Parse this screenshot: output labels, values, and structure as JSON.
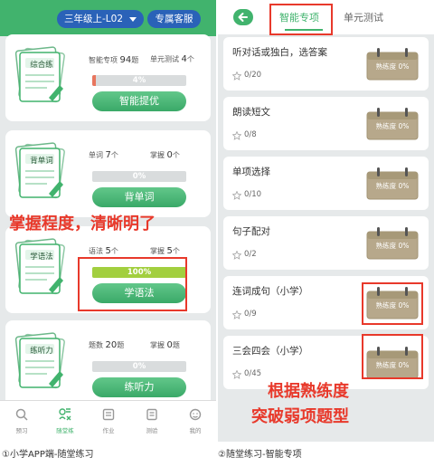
{
  "left": {
    "grade_selector": "三年级上-L02",
    "service_button": "专属客服",
    "cards": [
      {
        "illus_label": "综合练",
        "stat1_label": "智能专项",
        "stat1_value": "94",
        "stat1_unit": "题",
        "stat2_label": "单元测试",
        "stat2_value": "4",
        "stat2_unit": "个",
        "progress": "4%",
        "progress_value": 4,
        "bar_color": "#e8765e",
        "button": "智能提优"
      },
      {
        "illus_label": "背单词",
        "stat1_label": "单词",
        "stat1_value": "7",
        "stat1_unit": "个",
        "stat2_label": "掌握",
        "stat2_value": "0",
        "stat2_unit": "个",
        "progress": "0%",
        "progress_value": 0,
        "bar_color": "#d9dcdd",
        "button": "背单词"
      },
      {
        "illus_label": "学语法",
        "stat1_label": "语法",
        "stat1_value": "5",
        "stat1_unit": "个",
        "stat2_label": "掌握",
        "stat2_value": "5",
        "stat2_unit": "个",
        "progress": "100%",
        "progress_value": 100,
        "bar_color": "#a2cf3f",
        "button": "学语法"
      },
      {
        "illus_label": "练听力",
        "stat1_label": "题数",
        "stat1_value": "20",
        "stat1_unit": "题",
        "stat2_label": "掌握",
        "stat2_value": "0",
        "stat2_unit": "题",
        "progress": "0%",
        "progress_value": 0,
        "bar_color": "#d9dcdd",
        "button": "练听力"
      }
    ],
    "overlay_text": "掌握程度，清晰明了",
    "tabs": [
      {
        "label": "预习",
        "icon": "search-icon",
        "active": false
      },
      {
        "label": "随堂练",
        "icon": "class-practice-icon",
        "active": true
      },
      {
        "label": "作业",
        "icon": "homework-icon",
        "active": false
      },
      {
        "label": "测验",
        "icon": "quiz-icon",
        "active": false
      },
      {
        "label": "我的",
        "icon": "profile-icon",
        "active": false
      }
    ],
    "caption": "①小学APP端-随堂练习"
  },
  "right": {
    "tabs": [
      "智能专项",
      "单元测试"
    ],
    "items": [
      {
        "title": "听对话或独白，选答案",
        "count": "0/20",
        "badge": "熟练度 0%"
      },
      {
        "title": "朗读短文",
        "count": "0/8",
        "badge": "熟练度 0%"
      },
      {
        "title": "单项选择",
        "count": "0/10",
        "badge": "熟练度 0%"
      },
      {
        "title": "句子配对",
        "count": "0/2",
        "badge": "熟练度 0%"
      },
      {
        "title": "连词成句（小学）",
        "count": "0/9",
        "badge": "熟练度 0%"
      },
      {
        "title": "三会四会（小学）",
        "count": "0/45",
        "badge": "熟练度 0%"
      }
    ],
    "overlay_line1": "根据熟练度",
    "overlay_line2": "突破弱项题型",
    "caption": "②随堂练习-智能专项"
  },
  "colors": {
    "brand_green": "#41b36d",
    "header_blue": "#2a62b8",
    "highlight_red": "#e8392b",
    "badge_tan": "#b7a88b"
  }
}
